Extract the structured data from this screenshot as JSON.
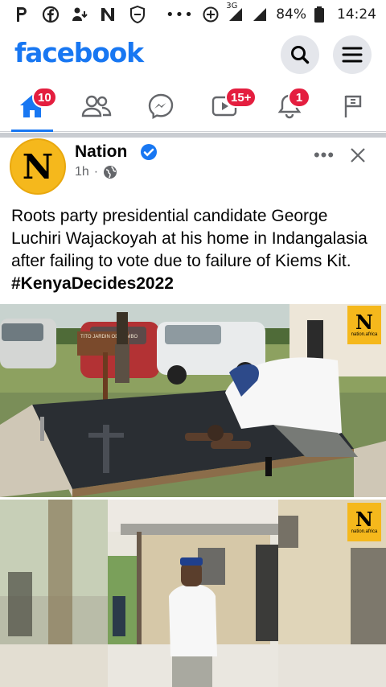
{
  "status_bar": {
    "network": "3G",
    "battery": "84%",
    "time": "14:24",
    "overflow": "•••",
    "left_icons": [
      "p-app-icon",
      "facebook-notif-icon",
      "download-icon",
      "n-app-icon",
      "shield-icon"
    ]
  },
  "header": {
    "logo": "facebook",
    "brand_color": "#1877f2"
  },
  "tabs": {
    "home_badge": "10",
    "video_badge": "15+",
    "notifications_badge": "1",
    "badge_color": "#e41e3f"
  },
  "post": {
    "avatar_letter": "N",
    "page_name": "Nation",
    "time": "1h",
    "separator": "·",
    "text": "Roots party presidential candidate George Luchiri Wajackoyah at his home in Indangalasia after failing to vote due to failure of Kiems Kit. ",
    "hashtag": "#KenyaDecides2022",
    "more": "•••",
    "watermark_letter": "N",
    "watermark_text": "nation.africa",
    "grave_sign": "TITO JARDIN ODHIAMBO"
  }
}
